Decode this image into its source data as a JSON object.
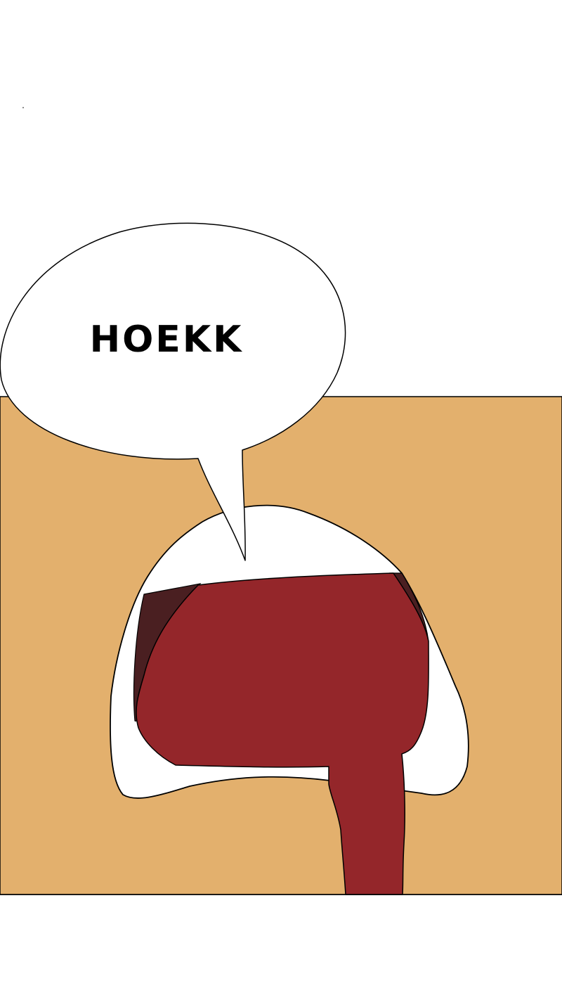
{
  "speech_bubble": {
    "text": "HOEKK"
  },
  "colors": {
    "page_background": "#ffffff",
    "panel_background": "#e3b06d",
    "creature_body": "#ffffff",
    "mouth_fill": "#94262a",
    "mouth_shadow": "#4a1f21",
    "outline": "#000000"
  }
}
